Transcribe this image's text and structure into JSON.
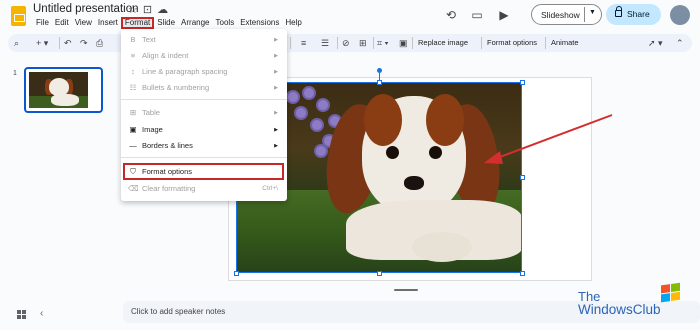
{
  "app": {
    "title": "Untitled presentation",
    "menus": [
      "File",
      "Edit",
      "View",
      "Insert",
      "Format",
      "Slide",
      "Arrange",
      "Tools",
      "Extensions",
      "Help"
    ],
    "active_menu": "Format"
  },
  "header": {
    "slideshow_label": "Slideshow",
    "share_label": "Share"
  },
  "toolbar": {
    "replace_image": "Replace image",
    "format_options": "Format options",
    "animate": "Animate"
  },
  "filmstrip": {
    "slide_number": "1"
  },
  "format_menu": {
    "items": [
      {
        "icon": "B",
        "label": "Text",
        "submenu": true,
        "enabled": false
      },
      {
        "icon": "",
        "label": "Align & indent",
        "submenu": true,
        "enabled": false
      },
      {
        "icon": "",
        "label": "Line & paragraph spacing",
        "submenu": true,
        "enabled": false
      },
      {
        "icon": "",
        "label": "Bullets & numbering",
        "submenu": true,
        "enabled": false
      },
      {
        "icon": "",
        "label": "Table",
        "submenu": true,
        "enabled": false
      },
      {
        "icon": "",
        "label": "Image",
        "submenu": true,
        "enabled": true
      },
      {
        "icon": "",
        "label": "Borders & lines",
        "submenu": true,
        "enabled": true
      },
      {
        "icon": "",
        "label": "Format options",
        "submenu": false,
        "enabled": true,
        "highlighted": true
      },
      {
        "icon": "",
        "label": "Clear formatting",
        "shortcut": "Ctrl+\\",
        "enabled": false
      }
    ]
  },
  "notes": {
    "placeholder": "Click to add speaker notes"
  },
  "watermark": {
    "the": "The",
    "main": "WindowsClub"
  },
  "colors": {
    "accent_blue": "#1a73e8",
    "highlight_red": "#c62828",
    "share_bg": "#c2e7ff",
    "slides_yellow": "#f4b400"
  }
}
